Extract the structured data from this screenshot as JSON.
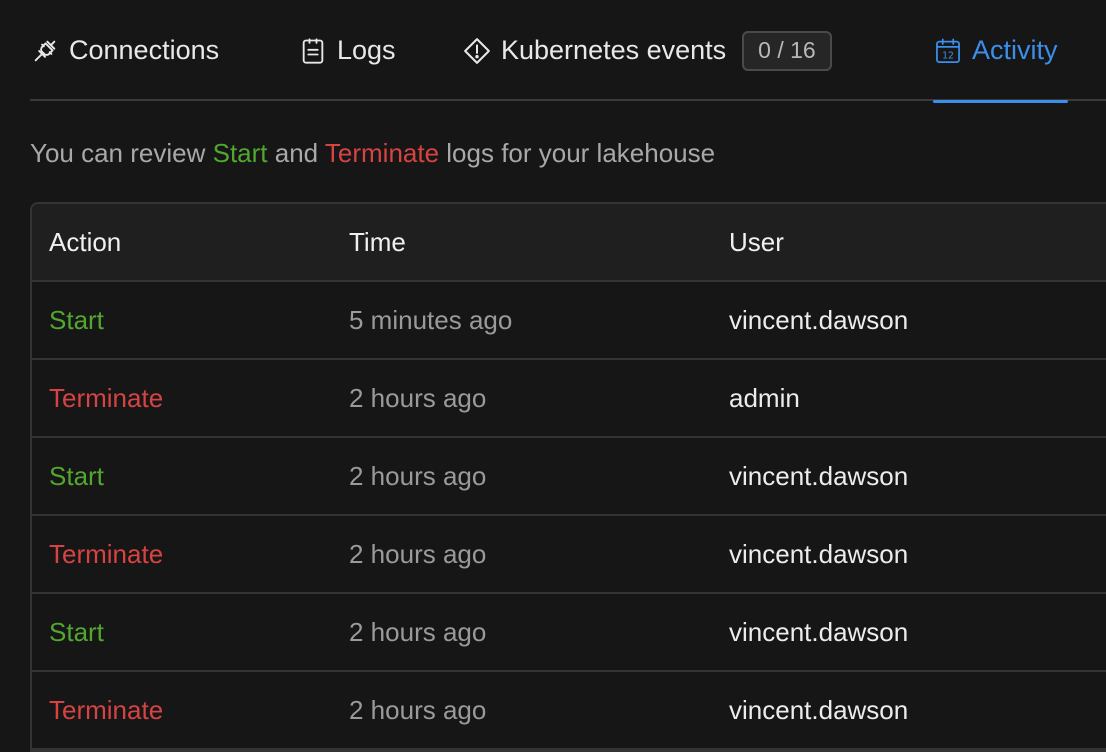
{
  "tabs": {
    "connections": {
      "label": "Connections",
      "icon": "plug-icon"
    },
    "logs": {
      "label": "Logs",
      "icon": "clipboard-icon"
    },
    "kubernetes": {
      "label": "Kubernetes events",
      "icon": "warning-diamond-icon",
      "badge": "0 / 16"
    },
    "activity": {
      "label": "Activity",
      "icon": "calendar-icon",
      "active": true
    }
  },
  "description": {
    "prefix": "You can review ",
    "start": "Start",
    "middle": " and ",
    "terminate": "Terminate",
    "suffix": " logs for your lakehouse"
  },
  "table": {
    "columns": [
      "Action",
      "Time",
      "User"
    ],
    "rows": [
      {
        "action": "Start",
        "type": "start",
        "time": "5 minutes ago",
        "user": "vincent.dawson"
      },
      {
        "action": "Terminate",
        "type": "terminate",
        "time": "2 hours ago",
        "user": "admin"
      },
      {
        "action": "Start",
        "type": "start",
        "time": "2 hours ago",
        "user": "vincent.dawson"
      },
      {
        "action": "Terminate",
        "type": "terminate",
        "time": "2 hours ago",
        "user": "vincent.dawson"
      },
      {
        "action": "Start",
        "type": "start",
        "time": "2 hours ago",
        "user": "vincent.dawson"
      },
      {
        "action": "Terminate",
        "type": "terminate",
        "time": "2 hours ago",
        "user": "vincent.dawson"
      }
    ]
  },
  "colors": {
    "accent": "#3b8eea",
    "start": "#52a72f",
    "terminate": "#d54343",
    "background": "#161616"
  }
}
